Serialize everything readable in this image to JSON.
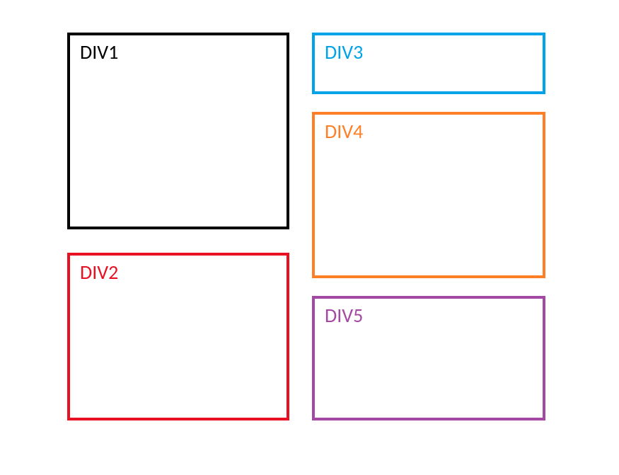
{
  "boxes": {
    "div1": {
      "label": "DIV1",
      "color": "#000000"
    },
    "div2": {
      "label": "DIV2",
      "color": "#e81123"
    },
    "div3": {
      "label": "DIV3",
      "color": "#00a2e8"
    },
    "div4": {
      "label": "DIV4",
      "color": "#ff7f27"
    },
    "div5": {
      "label": "DIV5",
      "color": "#a349a4"
    }
  }
}
